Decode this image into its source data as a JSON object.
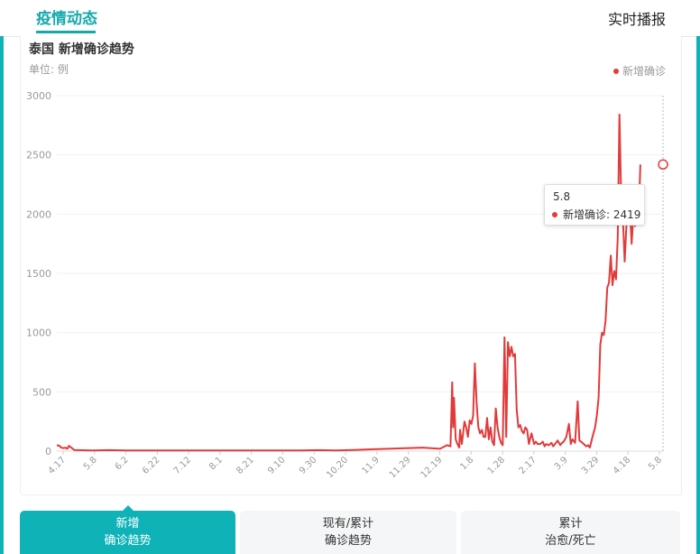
{
  "header": {
    "left_tab": "疫情动态",
    "right_tab": "实时播报"
  },
  "chart_title": "泰国 新增确诊趋势",
  "unit": "单位: 例",
  "legend_label": "新增确诊",
  "tooltip": {
    "date": "5.8",
    "label": "新增确诊: 2419"
  },
  "bottom_tabs": [
    {
      "line1": "新增",
      "line2": "确诊趋势",
      "active": true
    },
    {
      "line1": "现有/累计",
      "line2": "确诊趋势",
      "active": false
    },
    {
      "line1": "累计",
      "line2": "治愈/死亡",
      "active": false
    }
  ],
  "colors": {
    "accent": "#0fb3b7",
    "series": "#e23a3a"
  },
  "chart_data": {
    "type": "line",
    "title": "泰国 新增确诊趋势",
    "ylabel": "单位: 例",
    "ylim": [
      0,
      3000
    ],
    "yticks": [
      0,
      500,
      1000,
      1500,
      2000,
      2500,
      3000
    ],
    "xtick_labels": [
      "4.17",
      "5.8",
      "6.2",
      "6.22",
      "7.12",
      "8.1",
      "8.21",
      "9.10",
      "9.30",
      "10.20",
      "11.9",
      "11.29",
      "12.19",
      "1.8",
      "1.28",
      "2.17",
      "3.9",
      "3.29",
      "4.18",
      "5.8"
    ],
    "grid": true,
    "legend_position": "top-right",
    "series": [
      {
        "name": "新增确诊",
        "x_index": [
          0,
          3,
          5,
          8,
          10,
          12,
          14,
          20,
          40,
          60,
          80,
          100,
          120,
          140,
          160,
          180,
          200,
          220,
          240,
          260,
          280,
          300,
          320,
          340,
          360,
          380,
          400,
          420,
          440,
          448,
          452,
          454,
          455,
          456,
          458,
          460,
          462,
          463,
          465,
          468,
          470,
          472,
          474,
          476,
          478,
          480,
          482,
          484,
          486,
          488,
          490,
          492,
          494,
          496,
          498,
          500,
          502,
          504,
          506,
          508,
          510,
          512,
          514,
          516,
          518,
          520,
          522,
          524,
          526,
          528,
          530,
          532,
          534,
          536,
          538,
          540,
          542,
          545,
          548,
          550,
          552,
          555,
          558,
          560,
          562,
          565,
          568,
          570,
          572,
          575,
          578,
          580,
          582,
          585,
          588,
          590,
          592,
          595,
          598,
          600,
          602,
          605,
          608,
          610,
          612,
          615,
          618,
          620,
          622,
          624,
          626,
          628,
          630,
          632,
          634,
          636,
          638,
          640,
          642,
          644,
          646,
          648,
          650,
          652,
          654,
          656,
          658,
          660,
          662,
          664,
          666,
          668,
          670,
          672,
          674,
          676,
          678,
          680,
          682,
          684,
          686,
          688,
          690,
          692,
          694,
          696
        ],
        "values": [
          50,
          45,
          30,
          25,
          30,
          20,
          45,
          10,
          5,
          8,
          5,
          5,
          5,
          5,
          5,
          5,
          5,
          5,
          5,
          5,
          5,
          8,
          5,
          10,
          15,
          20,
          25,
          30,
          20,
          50,
          40,
          580,
          200,
          450,
          100,
          60,
          30,
          180,
          60,
          250,
          200,
          120,
          260,
          230,
          300,
          740,
          400,
          200,
          150,
          180,
          120,
          120,
          280,
          100,
          200,
          80,
          50,
          360,
          200,
          120,
          70,
          50,
          960,
          120,
          920,
          800,
          880,
          800,
          820,
          350,
          200,
          220,
          170,
          150,
          200,
          180,
          60,
          150,
          60,
          80,
          60,
          60,
          80,
          40,
          60,
          50,
          70,
          40,
          60,
          90,
          50,
          70,
          80,
          120,
          230,
          60,
          100,
          70,
          420,
          90,
          80,
          60,
          40,
          50,
          30,
          120,
          200,
          300,
          450,
          900,
          1000,
          980,
          1100,
          1380,
          1420,
          1650,
          1400,
          1520,
          1450,
          1800,
          2840,
          2100,
          1950,
          1600,
          1900,
          2000,
          2050,
          1750,
          2000,
          1900,
          2100,
          1970,
          2419
        ]
      }
    ]
  }
}
